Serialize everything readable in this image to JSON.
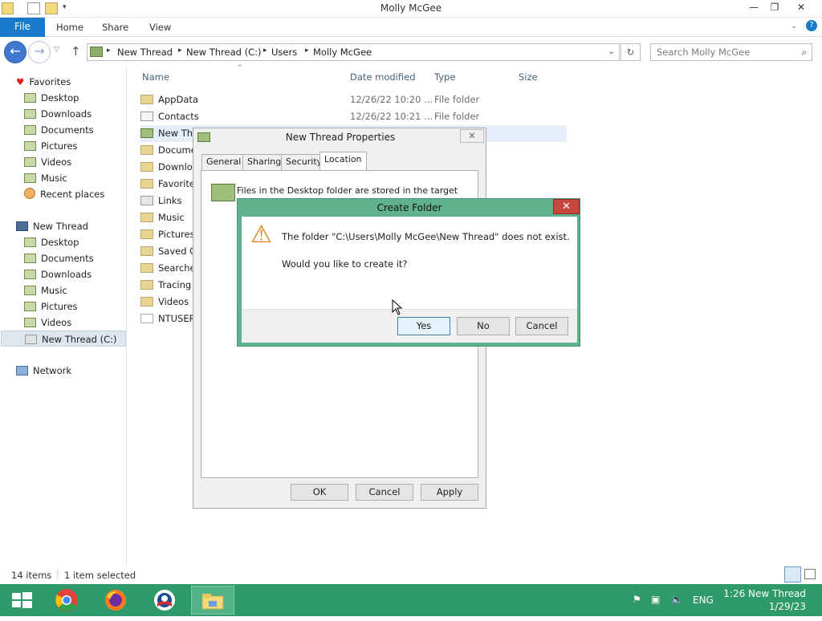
{
  "window": {
    "title": "Molly McGee",
    "min": "—",
    "max": "❐",
    "close": "✕",
    "help": "?"
  },
  "ribbon": {
    "file": "File",
    "tabs": [
      "Home",
      "Share",
      "View"
    ]
  },
  "address": {
    "crumbs": [
      "New Thread",
      "New Thread (C:)",
      "Users",
      "Molly McGee"
    ],
    "search_placeholder": "Search Molly McGee"
  },
  "nav": {
    "favorites_header": "Favorites",
    "favorites": [
      "Desktop",
      "Downloads",
      "Documents",
      "Pictures",
      "Videos",
      "Music",
      "Recent places"
    ],
    "thispc_header": "New Thread",
    "thispc": [
      "Desktop",
      "Documents",
      "Downloads",
      "Music",
      "Pictures",
      "Videos",
      "New Thread (C:)"
    ],
    "network": "Network"
  },
  "columns": {
    "name": "Name",
    "date": "Date modified",
    "type": "Type",
    "size": "Size"
  },
  "files": [
    {
      "name": "AppData",
      "date": "12/26/22 10:20 ...",
      "type": "File folder"
    },
    {
      "name": "Contacts",
      "date": "12/26/22 10:21 ...",
      "type": "File folder"
    },
    {
      "name": "New Thr",
      "date": "",
      "type": ""
    },
    {
      "name": "Docume",
      "date": "",
      "type": ""
    },
    {
      "name": "Downlo",
      "date": "",
      "type": ""
    },
    {
      "name": "Favorite",
      "date": "",
      "type": ""
    },
    {
      "name": "Links",
      "date": "",
      "type": ""
    },
    {
      "name": "Music",
      "date": "",
      "type": ""
    },
    {
      "name": "Pictures",
      "date": "",
      "type": ""
    },
    {
      "name": "Saved G",
      "date": "",
      "type": ""
    },
    {
      "name": "Searche",
      "date": "",
      "type": ""
    },
    {
      "name": "Tracing",
      "date": "",
      "type": ""
    },
    {
      "name": "Videos",
      "date": "",
      "type": ""
    },
    {
      "name": "NTUSER",
      "date": "",
      "type": ""
    }
  ],
  "status": {
    "items": "14 items",
    "selected": "1 item selected"
  },
  "properties": {
    "title": "New Thread Properties",
    "tabs": [
      "General",
      "Sharing",
      "Security",
      "Location"
    ],
    "location_text": "Files in the Desktop folder are stored in the target",
    "ok": "OK",
    "cancel": "Cancel",
    "apply": "Apply",
    "close": "✕"
  },
  "create_folder": {
    "title": "Create Folder",
    "message": "The folder \"C:\\Users\\Molly McGee\\New Thread\" does not exist.",
    "question": "Would you like to create it?",
    "yes": "Yes",
    "no": "No",
    "cancel": "Cancel",
    "close": "✕",
    "warning_icon": "⚠"
  },
  "taskbar": {
    "lang": "ENG",
    "time": "1:26 New Thread",
    "date": "1/29/23"
  }
}
